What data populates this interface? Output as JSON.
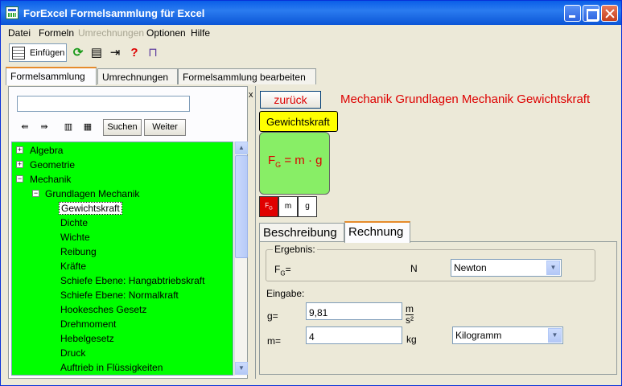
{
  "window": {
    "title": "ForExcel Formelsammlung für Excel"
  },
  "menu": [
    {
      "label": "Datei",
      "disabled": false
    },
    {
      "label": "Formeln",
      "disabled": false
    },
    {
      "label": "Umrechnungen",
      "disabled": true
    },
    {
      "label": "Optionen",
      "disabled": false
    },
    {
      "label": "Hilfe",
      "disabled": false
    }
  ],
  "toolbar": {
    "insert_label": "Einfügen"
  },
  "outer_tabs": [
    "Formelsammlung",
    "Umrechnungen",
    "Formelsammlung bearbeiten"
  ],
  "left": {
    "search_value": "",
    "search_button": "Suchen",
    "next_button": "Weiter",
    "close_glyph": "x",
    "tree": [
      {
        "label": "Algebra",
        "expander": "+"
      },
      {
        "label": "Geometrie",
        "expander": "+"
      },
      {
        "label": "Mechanik",
        "expander": "−"
      },
      {
        "label": "Grundlagen Mechanik",
        "expander": "−"
      },
      {
        "label": "Gewichtskraft",
        "selected": true
      },
      {
        "label": "Dichte"
      },
      {
        "label": "Wichte"
      },
      {
        "label": "Reibung"
      },
      {
        "label": "Kräfte"
      },
      {
        "label": "Schiefe Ebene: Hangabtriebskraft"
      },
      {
        "label": "Schiefe Ebene: Normalkraft"
      },
      {
        "label": "Hookesches Gesetz"
      },
      {
        "label": "Drehmoment"
      },
      {
        "label": "Hebelgesetz"
      },
      {
        "label": "Druck"
      },
      {
        "label": "Auftrieb in Flüssigkeiten"
      }
    ]
  },
  "right": {
    "back_button": "zurück",
    "breadcrumb": "Mechanik  Grundlagen Mechanik  Gewichtskraft",
    "formula_name": "Gewichtskraft",
    "formula": {
      "lhs": "F",
      "lhs_sub": "G",
      "rhs": "= m · g"
    },
    "variables": [
      {
        "label": "F",
        "sub": "G"
      },
      {
        "label": "m",
        "sub": ""
      },
      {
        "label": "g",
        "sub": ""
      }
    ],
    "inner_tabs": [
      "Beschreibung",
      "Rechnung"
    ],
    "ergebnis": {
      "group_label": "Ergebnis:",
      "var": "F",
      "var_sub": "G",
      "eq": "=",
      "unit": "N",
      "unit_select": "Newton"
    },
    "eingabe": {
      "label": "Eingabe:",
      "g_label": "g=",
      "g_value": "9,81",
      "g_unit_num": "m",
      "g_unit_den": "s²",
      "m_label": "m=",
      "m_value": "4",
      "m_unit": "kg",
      "m_unit_select": "Kilogramm"
    }
  },
  "colors": {
    "tree_bg": "#00ff00",
    "formula_bg": "#88ee66",
    "accent_red": "#dd0000",
    "tag_yellow": "#ffff00"
  }
}
